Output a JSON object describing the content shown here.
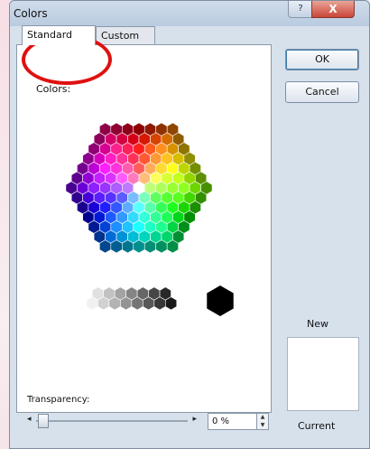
{
  "window": {
    "title": "Colors",
    "help_glyph": "?",
    "close_glyph": "X"
  },
  "tabs": [
    {
      "label": "Standard"
    },
    {
      "label": "Custom"
    }
  ],
  "panel": {
    "colors_label": "Colors:"
  },
  "buttons": {
    "ok": "OK",
    "cancel": "Cancel"
  },
  "preview": {
    "new_label": "New",
    "current_label": "Current"
  },
  "transparency": {
    "label": "Transparency:",
    "value_text": "0 %",
    "level": 0
  },
  "icons": {
    "slider_left": "◂",
    "slider_right": "▸",
    "spin_up": "▲",
    "spin_down": "▼"
  }
}
